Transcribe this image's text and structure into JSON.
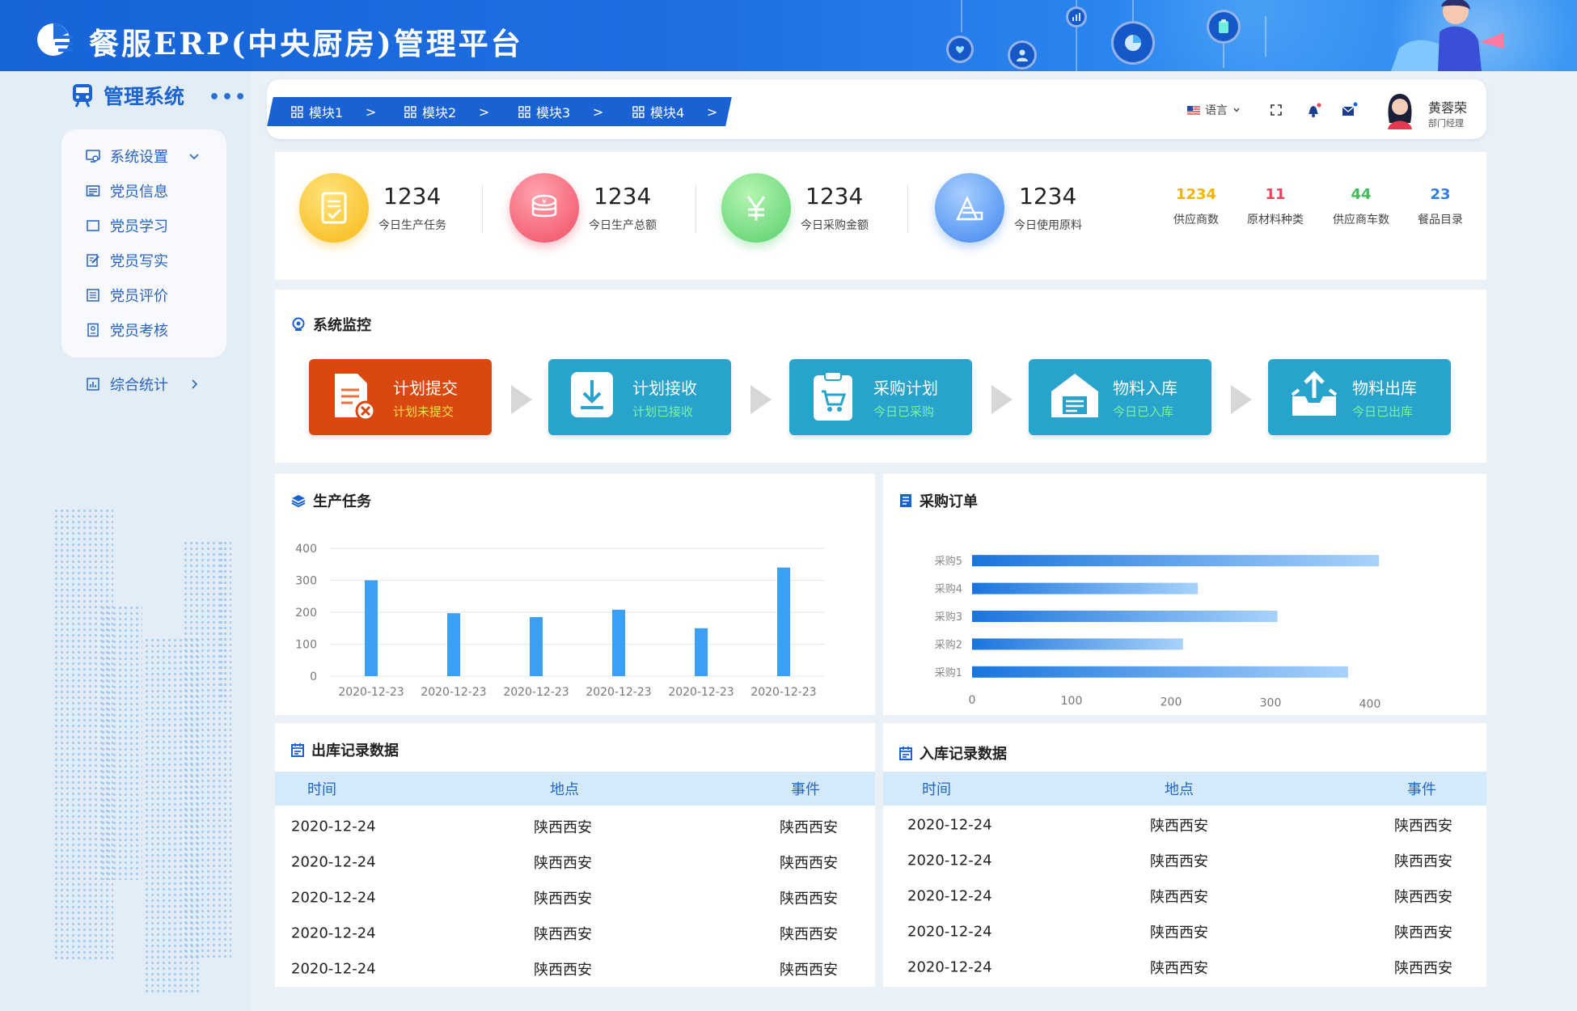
{
  "header": {
    "title": "餐服ERP(中央厨房)管理平台"
  },
  "sidebar": {
    "system_title": "管理系统",
    "more": "•••",
    "items": [
      {
        "label": "系统设置",
        "icon": "settings-monitor-icon"
      },
      {
        "label": "党员信息",
        "icon": "card-icon"
      },
      {
        "label": "党员学习",
        "icon": "book-icon"
      },
      {
        "label": "党员写实",
        "icon": "edit-icon"
      },
      {
        "label": "党员评价",
        "icon": "list-icon"
      },
      {
        "label": "党员考核",
        "icon": "assessment-icon"
      }
    ],
    "stats_item": {
      "label": "综合统计",
      "icon": "chart-icon"
    }
  },
  "topbar": {
    "breadcrumbs": [
      "模块1",
      "模块2",
      "模块3",
      "模块4"
    ],
    "language": "语言",
    "user": {
      "name": "黄蓉荣",
      "role": "部门经理"
    }
  },
  "stats": {
    "main": [
      {
        "value": "1234",
        "label": "今日生产任务",
        "color": "#ffc21f"
      },
      {
        "value": "1234",
        "label": "今日生产总额",
        "color": "#f45a6f"
      },
      {
        "value": "1234",
        "label": "今日采购金额",
        "color": "#6fd67a"
      },
      {
        "value": "1234",
        "label": "今日使用原料",
        "color": "#4a8ff2"
      }
    ],
    "mini": [
      {
        "value": "1234",
        "label": "供应商数",
        "color": "#f5b400"
      },
      {
        "value": "11",
        "label": "原材料种类",
        "color": "#f0445b"
      },
      {
        "value": "44",
        "label": "供应商车数",
        "color": "#3fbf58"
      },
      {
        "value": "23",
        "label": "餐品目录",
        "color": "#2f7ee6"
      }
    ]
  },
  "monitor": {
    "title": "系统监控",
    "steps": [
      {
        "title": "计划提交",
        "sub": "计划未提交",
        "color": "#d9480f",
        "sub_color": "#ffe04a"
      },
      {
        "title": "计划接收",
        "sub": "计划已接收",
        "color": "#27a3cc",
        "sub_color": "#7df3a2"
      },
      {
        "title": "采购计划",
        "sub": "今日已采购",
        "color": "#27a3cc",
        "sub_color": "#7df3a2"
      },
      {
        "title": "物料入库",
        "sub": "今日已入库",
        "color": "#27a3cc",
        "sub_color": "#7df3a2"
      },
      {
        "title": "物料出库",
        "sub": "今日已出库",
        "color": "#27a3cc",
        "sub_color": "#7df3a2"
      }
    ]
  },
  "production": {
    "title": "生产任务"
  },
  "purchase": {
    "title": "采购订单"
  },
  "outbound": {
    "title": "出库记录数据",
    "columns": [
      "时间",
      "地点",
      "事件"
    ],
    "rows": [
      [
        "2020-12-24",
        "陕西西安",
        "陕西西安"
      ],
      [
        "2020-12-24",
        "陕西西安",
        "陕西西安"
      ],
      [
        "2020-12-24",
        "陕西西安",
        "陕西西安"
      ],
      [
        "2020-12-24",
        "陕西西安",
        "陕西西安"
      ],
      [
        "2020-12-24",
        "陕西西安",
        "陕西西安"
      ]
    ]
  },
  "inbound": {
    "title": "入库记录数据",
    "columns": [
      "时间",
      "地点",
      "事件"
    ],
    "rows": [
      [
        "2020-12-24",
        "陕西西安",
        "陕西西安"
      ],
      [
        "2020-12-24",
        "陕西西安",
        "陕西西安"
      ],
      [
        "2020-12-24",
        "陕西西安",
        "陕西西安"
      ],
      [
        "2020-12-24",
        "陕西西安",
        "陕西西安"
      ],
      [
        "2020-12-24",
        "陕西西安",
        "陕西西安"
      ]
    ]
  },
  "chart_data": [
    {
      "type": "bar",
      "title": "生产任务",
      "categories": [
        "2020-12-23",
        "2020-12-23",
        "2020-12-23",
        "2020-12-23",
        "2020-12-23",
        "2020-12-23"
      ],
      "values": [
        300,
        197,
        185,
        208,
        150,
        340
      ],
      "ylim": [
        0,
        400
      ],
      "yticks": [
        0,
        100,
        200,
        300,
        400
      ],
      "grid": true,
      "color": "#3aa0f5"
    },
    {
      "type": "bar",
      "orientation": "horizontal",
      "title": "采购订单",
      "categories": [
        "采购1",
        "采购2",
        "采购3",
        "采购4",
        "采购5"
      ],
      "values": [
        378,
        212,
        307,
        227,
        409
      ],
      "xlim": [
        0,
        400
      ],
      "xticks": [
        0,
        100,
        200,
        300,
        400
      ],
      "color": "#1f7ee0"
    }
  ]
}
